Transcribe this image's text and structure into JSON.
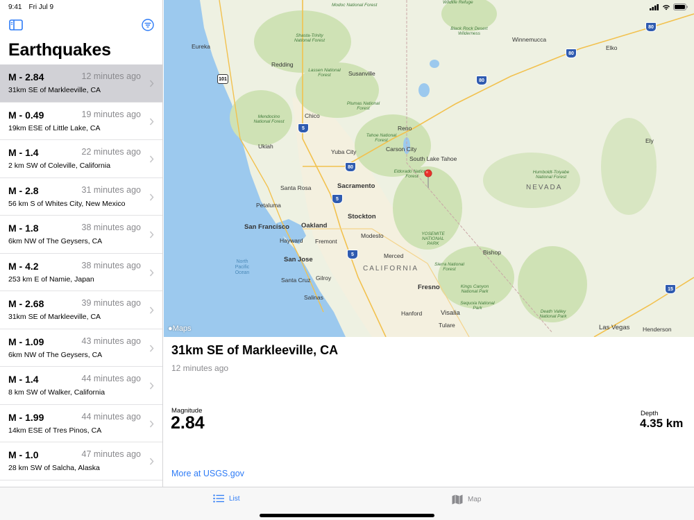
{
  "status": {
    "time": "9:41",
    "date": "Fri Jul 9"
  },
  "sidebar": {
    "title": "Earthquakes",
    "toggle_icon": "sidebar-icon",
    "filter_icon": "filter-circle-icon",
    "items": [
      {
        "magnitude": "M - 2.84",
        "time": "12 minutes ago",
        "place": "31km SE of Markleeville, CA",
        "selected": true
      },
      {
        "magnitude": "M - 0.49",
        "time": "19 minutes ago",
        "place": "19km ESE of Little Lake, CA"
      },
      {
        "magnitude": "M - 1.4",
        "time": "22 minutes ago",
        "place": "2 km SW of Coleville, California"
      },
      {
        "magnitude": "M - 2.8",
        "time": "31 minutes ago",
        "place": "56 km S of Whites City, New Mexico"
      },
      {
        "magnitude": "M - 1.8",
        "time": "38 minutes ago",
        "place": "6km NW of The Geysers, CA"
      },
      {
        "magnitude": "M - 4.2",
        "time": "38 minutes ago",
        "place": "253 km E of Namie, Japan"
      },
      {
        "magnitude": "M - 2.68",
        "time": "39 minutes ago",
        "place": "31km SE of Markleeville, CA"
      },
      {
        "magnitude": "M - 1.09",
        "time": "43 minutes ago",
        "place": "6km NW of The Geysers, CA"
      },
      {
        "magnitude": "M - 1.4",
        "time": "44 minutes ago",
        "place": "8 km SW of Walker, California"
      },
      {
        "magnitude": "M - 1.99",
        "time": "44 minutes ago",
        "place": "14km ESE of Tres Pinos, CA"
      },
      {
        "magnitude": "M - 1.0",
        "time": "47 minutes ago",
        "place": "28 km SW of Salcha, Alaska"
      }
    ]
  },
  "map": {
    "attribution": "Maps",
    "labels": {
      "modoc": "Modoc National Forest",
      "wildlife": "Wildlife Refuge",
      "blackrock": "Black Rock Desert Wilderness",
      "winnemucca": "Winnemucca",
      "elko": "Elko",
      "eureka": "Eureka",
      "shasta": "Shasta-Trinity National Forest",
      "redding": "Redding",
      "lassen": "Lassen National Forest",
      "susanville": "Susanville",
      "plumas": "Plumas National Forest",
      "mendocino": "Mendocino National Forest",
      "chico": "Chico",
      "reno": "Reno",
      "tahoenf": "Tahoe National Forest",
      "ukiah": "Ukiah",
      "yubacity": "Yuba City",
      "carsoncity": "Carson City",
      "southlaketahoe": "South Lake Tahoe",
      "ely": "Ely",
      "humboldt": "Humboldt-Toiyabe National Forest",
      "eldorado": "Eldorado National Forest",
      "nevada": "NEVADA",
      "santarosa": "Santa Rosa",
      "sacramento": "Sacramento",
      "petaluma": "Petaluma",
      "stockton": "Stockton",
      "sanfrancisco": "San Francisco",
      "oakland": "Oakland",
      "hayward": "Hayward",
      "fremont": "Fremont",
      "modesto": "Modesto",
      "yosemite": "YOSEMITE NATIONAL PARK",
      "sanjose": "San Jose",
      "merced": "Merced",
      "california": "CALIFORNIA",
      "bishop": "Bishop",
      "sierra": "Sierra National Forest",
      "northpacific": "North Pacific Ocean",
      "santacruz": "Santa Cruz",
      "gilroy": "Gilroy",
      "fresno": "Fresno",
      "kings": "Kings Canyon National Park",
      "salinas": "Salinas",
      "sequoia": "Sequoia National Park",
      "hanford": "Hanford",
      "visalia": "Visalia",
      "tulare": "Tulare",
      "deathvalley": "Death Valley National Park",
      "lasvegas": "Las Vegas",
      "henderson": "Henderson"
    },
    "shields": {
      "i80a": "80",
      "i80b": "80",
      "i80c": "80",
      "i80d": "80",
      "i5a": "5",
      "i5b": "5",
      "i5c": "5",
      "us101": "101",
      "i15": "15"
    }
  },
  "detail": {
    "title": "31km SE of Markleeville, CA",
    "time": "12 minutes ago",
    "magnitude_label": "Magnitude",
    "magnitude_value": "2.84",
    "depth_label": "Depth",
    "depth_value": "4.35 km",
    "link": "More at USGS.gov"
  },
  "tabs": {
    "list_label": "List",
    "map_label": "Map",
    "active_color": "#2d7bf6",
    "inactive_color": "#8a8a8e"
  }
}
